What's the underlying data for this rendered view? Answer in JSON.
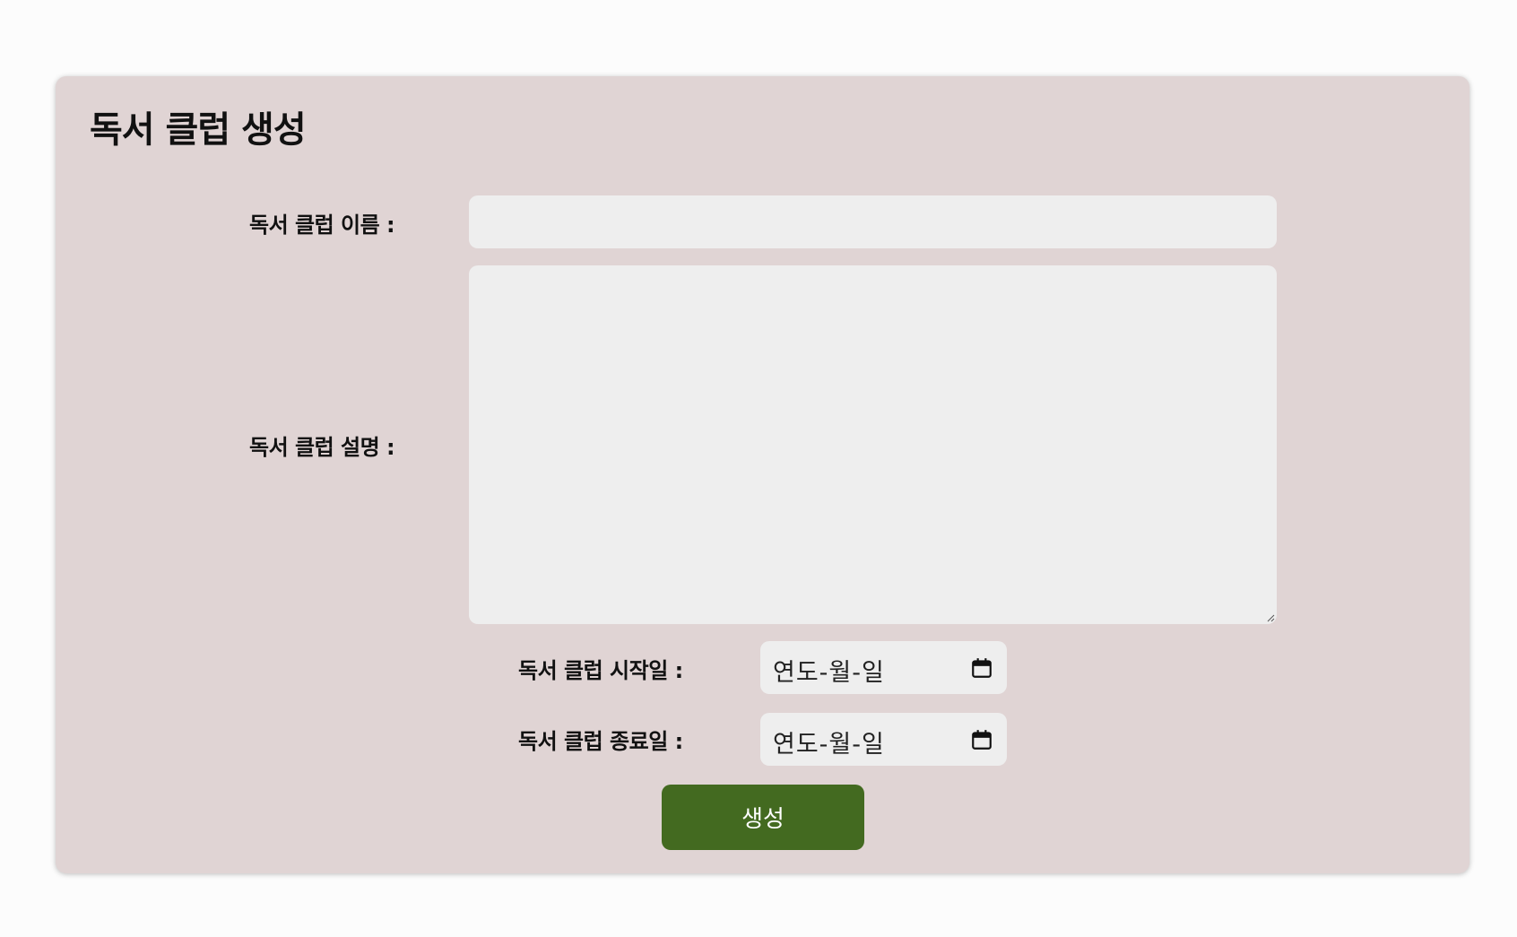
{
  "page": {
    "title": "독서 클럽 생성"
  },
  "form": {
    "name": {
      "label": "독서 클럽 이름 :",
      "value": ""
    },
    "description": {
      "label": "독서 클럽 설명 :",
      "value": ""
    },
    "start_date": {
      "label": "독서 클럽 시작일 :",
      "placeholder": "연도-월-일",
      "icon": "calendar-icon"
    },
    "end_date": {
      "label": "독서 클럽 종료일 :",
      "placeholder": "연도-월-일",
      "icon": "calendar-icon"
    },
    "submit_label": "생성"
  },
  "colors": {
    "page_background": "#fcfcfc",
    "card_background": "#e0d4d4",
    "field_background": "#eeeeee",
    "button_background": "#436a20",
    "button_text": "#ffffff"
  }
}
